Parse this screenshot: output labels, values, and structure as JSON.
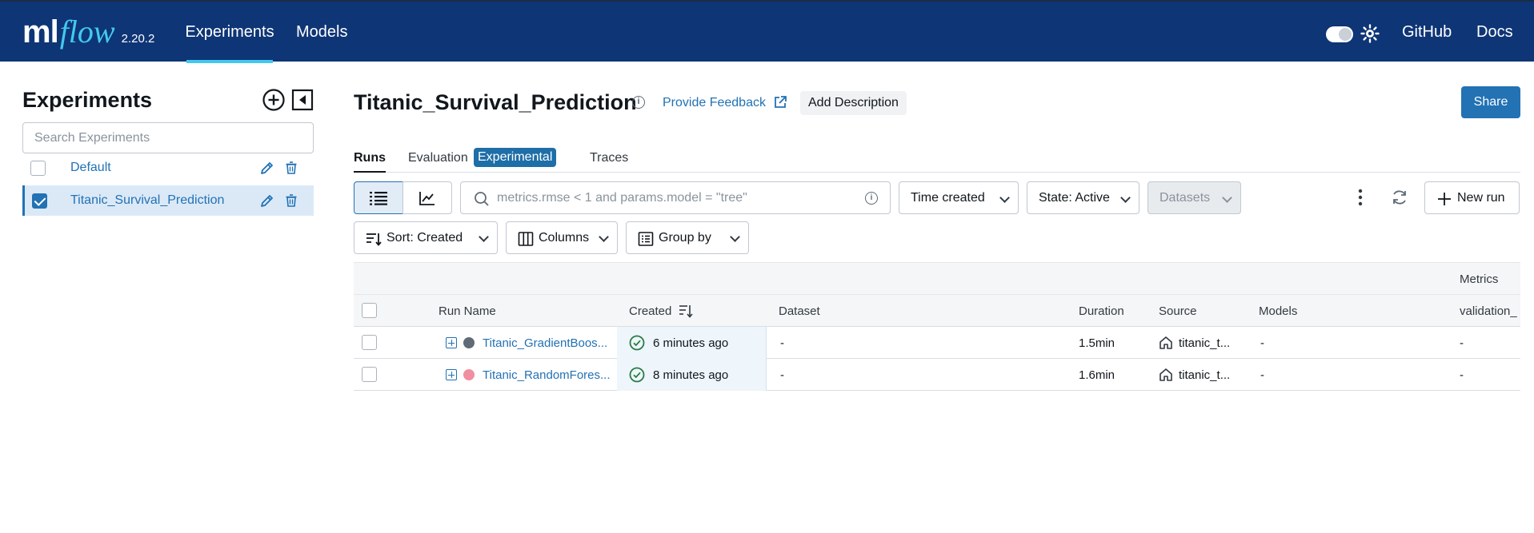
{
  "app": {
    "logo_ml": "ml",
    "logo_flow": "flow",
    "version": "2.20.2",
    "nav": {
      "experiments": "Experiments",
      "models": "Models",
      "github": "GitHub",
      "docs": "Docs"
    }
  },
  "sidebar": {
    "title": "Experiments",
    "search_placeholder": "Search Experiments",
    "experiments": [
      {
        "name": "Default",
        "checked": false
      },
      {
        "name": "Titanic_Survival_Prediction",
        "checked": true
      }
    ]
  },
  "header": {
    "title": "Titanic_Survival_Prediction",
    "info_glyph": "i",
    "feedback": "Provide Feedback",
    "add_description": "Add Description",
    "share": "Share"
  },
  "tabs": {
    "runs": "Runs",
    "evaluation": "Evaluation",
    "experimental_tag": "Experimental",
    "traces": "Traces"
  },
  "toolbar": {
    "search_placeholder": "metrics.rmse < 1 and params.model = \"tree\"",
    "time_created": "Time created",
    "state": "State: Active",
    "datasets": "Datasets",
    "new_run": "New run",
    "sort": "Sort: Created",
    "columns": "Columns",
    "group_by": "Group by"
  },
  "table": {
    "group_header": "Metrics",
    "columns": {
      "run_name": "Run Name",
      "created": "Created",
      "dataset": "Dataset",
      "duration": "Duration",
      "source": "Source",
      "models": "Models",
      "validation": "validation_"
    },
    "rows": [
      {
        "run_name": "Titanic_GradientBoos...",
        "dot_color": "#5f6b76",
        "created": "6 minutes ago",
        "dataset": "-",
        "duration": "1.5min",
        "source": "titanic_t...",
        "models": "-",
        "validation": "-"
      },
      {
        "run_name": "Titanic_RandomFores...",
        "dot_color": "#f08fa0",
        "created": "8 minutes ago",
        "dataset": "-",
        "duration": "1.6min",
        "source": "titanic_t...",
        "models": "-",
        "validation": "-"
      }
    ]
  },
  "colors": {
    "topbar": "#0e3576",
    "accent": "#2272b4",
    "logo_flow": "#43c9ed",
    "success": "#277c43"
  }
}
